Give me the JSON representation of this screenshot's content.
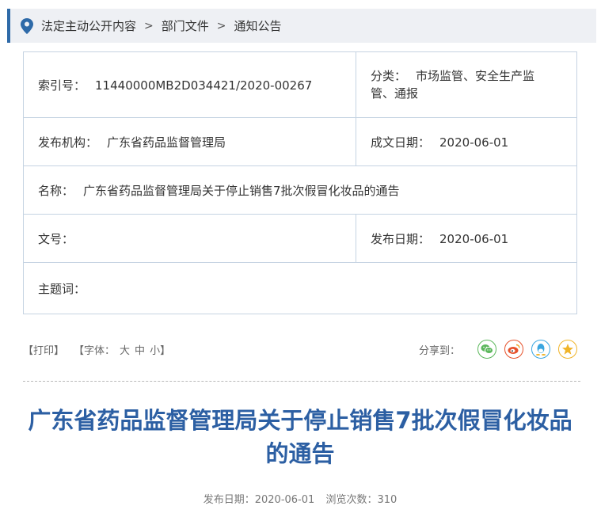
{
  "breadcrumb": {
    "items": [
      "法定主动公开内容",
      "部门文件",
      "通知公告"
    ],
    "separator": ">"
  },
  "info": {
    "index_label": "索引号：",
    "index_value": "11440000MB2D034421/2020-00267",
    "category_label": "分类：",
    "category_value": "市场监管、安全生产监管、通报",
    "issuer_label": "发布机构：",
    "issuer_value": "广东省药品监督管理局",
    "created_label": "成文日期：",
    "created_value": "2020-06-01",
    "name_label": "名称：",
    "name_value": "广东省药品监督管理局关于停止销售7批次假冒化妆品的通告",
    "docno_label": "文号：",
    "docno_value": "",
    "published_label": "发布日期：",
    "published_value": "2020-06-01",
    "keywords_label": "主题词：",
    "keywords_value": ""
  },
  "toolbar": {
    "print": "【打印】",
    "font_prefix": "【字体：",
    "font_large": "大",
    "font_medium": "中",
    "font_small": "小",
    "font_suffix": "】",
    "share_label": "分享到：",
    "share_icons": [
      "wechat-icon",
      "weibo-icon",
      "qq-icon",
      "qzone-icon"
    ]
  },
  "article": {
    "title": "广东省药品监督管理局关于停止销售7批次假冒化妆品的通告",
    "publish_label": "发布日期：",
    "publish_date": "2020-06-01",
    "views_label": "浏览次数：",
    "views": "310"
  },
  "colors": {
    "accent": "#2e6aa8",
    "title": "#2c5fa3",
    "wechat": "#5bb75b",
    "weibo": "#e6512b",
    "qq": "#3aa6e0",
    "qzone": "#f0b429"
  }
}
